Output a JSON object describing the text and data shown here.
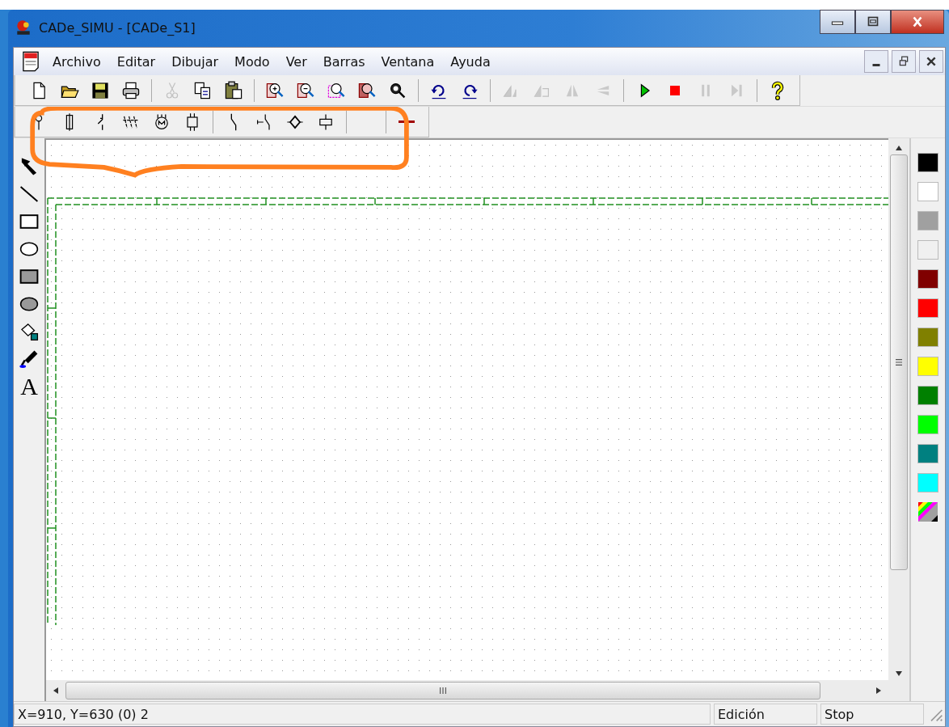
{
  "window": {
    "title": "CADe_SIMU - [CADe_S1]"
  },
  "menu": [
    "Archivo",
    "Editar",
    "Dibujar",
    "Modo",
    "Ver",
    "Barras",
    "Ventana",
    "Ayuda"
  ],
  "toolbar": [
    {
      "kind": "button",
      "disabled": false
    },
    {
      "kind": "button",
      "disabled": false
    },
    {
      "kind": "button",
      "disabled": false
    },
    {
      "kind": "button",
      "disabled": false
    },
    {
      "kind": "separator"
    },
    {
      "kind": "button",
      "disabled": true
    },
    {
      "kind": "button",
      "disabled": false
    },
    {
      "kind": "button",
      "disabled": false
    },
    {
      "kind": "separator"
    },
    {
      "kind": "button",
      "disabled": false
    },
    {
      "kind": "button",
      "disabled": false
    },
    {
      "kind": "button",
      "disabled": false
    },
    {
      "kind": "button",
      "disabled": false
    },
    {
      "kind": "button",
      "disabled": false
    },
    {
      "kind": "separator"
    },
    {
      "kind": "button",
      "disabled": false
    },
    {
      "kind": "button",
      "disabled": false
    },
    {
      "kind": "separator"
    },
    {
      "kind": "button",
      "disabled": true
    },
    {
      "kind": "button",
      "disabled": true
    },
    {
      "kind": "button",
      "disabled": true
    },
    {
      "kind": "button",
      "disabled": true
    },
    {
      "kind": "separator"
    },
    {
      "kind": "button",
      "disabled": false
    },
    {
      "kind": "button",
      "disabled": false
    },
    {
      "kind": "button",
      "disabled": true
    },
    {
      "kind": "button",
      "disabled": true
    },
    {
      "kind": "separator"
    },
    {
      "kind": "button",
      "disabled": false
    }
  ],
  "component_toolbar": [
    {
      "kind": "button"
    },
    {
      "kind": "button"
    },
    {
      "kind": "button"
    },
    {
      "kind": "button"
    },
    {
      "kind": "button"
    },
    {
      "kind": "button"
    },
    {
      "kind": "separator"
    },
    {
      "kind": "button"
    },
    {
      "kind": "button"
    },
    {
      "kind": "button"
    },
    {
      "kind": "button"
    },
    {
      "kind": "separator"
    },
    {
      "kind": "blank"
    },
    {
      "kind": "separator"
    },
    {
      "kind": "button"
    }
  ],
  "drawing_tools": [
    {
      "kind": "icon"
    },
    {
      "kind": "icon"
    },
    {
      "kind": "icon"
    },
    {
      "kind": "icon"
    },
    {
      "kind": "icon"
    },
    {
      "kind": "icon"
    },
    {
      "kind": "icon"
    },
    {
      "kind": "icon"
    },
    {
      "kind": "text",
      "label": "A"
    }
  ],
  "palette": [
    {
      "kind": "swatch",
      "color": "#000000"
    },
    {
      "kind": "swatch",
      "color": "#ffffff"
    },
    {
      "kind": "swatch",
      "color": "#a0a0a0"
    },
    {
      "kind": "swatch",
      "color": "#f0f0f0"
    },
    {
      "kind": "swatch",
      "color": "#800000"
    },
    {
      "kind": "swatch",
      "color": "#ff0000"
    },
    {
      "kind": "swatch",
      "color": "#808000"
    },
    {
      "kind": "swatch",
      "color": "#ffff00"
    },
    {
      "kind": "swatch",
      "color": "#008000"
    },
    {
      "kind": "swatch",
      "color": "#00ff00"
    },
    {
      "kind": "swatch",
      "color": "#008080"
    },
    {
      "kind": "swatch",
      "color": "#00ffff"
    },
    {
      "kind": "custom"
    }
  ],
  "status_bar": {
    "position": "X=910, Y=630 (0) 2",
    "mode": "Edición",
    "state": "Stop"
  }
}
